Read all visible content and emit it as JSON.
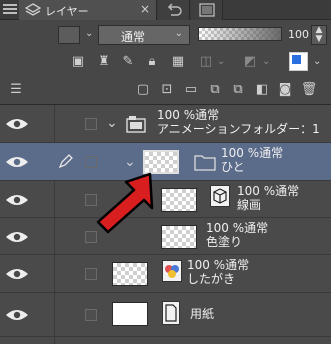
{
  "tabs": {
    "active_label": "レイヤー"
  },
  "blend": {
    "mode": "通常",
    "opacity": "100"
  },
  "colors": {
    "bg": "#474747",
    "selected_row": "#5b6b8a",
    "arrow_red": "#d81e1e"
  },
  "layers": [
    {
      "name_line1": "100 %通常",
      "name_line2": "アニメーションフォルダー：1"
    },
    {
      "name_line1": "100 %通常",
      "name_line2": "ひと"
    },
    {
      "name_line1": "100 %通常",
      "name_line2": "線画"
    },
    {
      "name_line1": "100 %通常",
      "name_line2": "色塗り"
    },
    {
      "name_line1": "100 %通常",
      "name_line2": "したがき"
    },
    {
      "name_line1": "用紙"
    }
  ]
}
